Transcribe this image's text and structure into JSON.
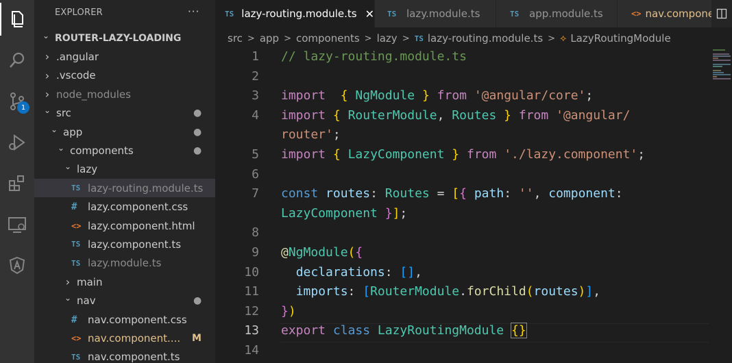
{
  "explorer": {
    "title": "EXPLORER",
    "more_icon": "ellipsis-icon",
    "tree": [
      {
        "label": "ROUTER-LAZY-LOADING",
        "type": "root-folder",
        "expanded": true,
        "depth": 0
      },
      {
        "label": ".angular",
        "type": "folder",
        "expanded": false,
        "depth": 1
      },
      {
        "label": ".vscode",
        "type": "folder",
        "expanded": false,
        "depth": 1
      },
      {
        "label": "node_modules",
        "type": "folder",
        "expanded": false,
        "depth": 1,
        "dimmed": true
      },
      {
        "label": "src",
        "type": "folder",
        "expanded": true,
        "depth": 1,
        "decoration": "●"
      },
      {
        "label": "app",
        "type": "folder",
        "expanded": true,
        "depth": 2,
        "decoration": "●"
      },
      {
        "label": "components",
        "type": "folder",
        "expanded": true,
        "depth": 3,
        "decoration": "●"
      },
      {
        "label": "lazy",
        "type": "folder",
        "expanded": true,
        "depth": 4
      },
      {
        "label": "lazy-routing.module.ts",
        "type": "ts",
        "icon": "TS",
        "depth": 5,
        "selected": true,
        "dimmed": true
      },
      {
        "label": "lazy.component.css",
        "type": "css",
        "icon": "#",
        "depth": 5
      },
      {
        "label": "lazy.component.html",
        "type": "html",
        "icon": "<>",
        "depth": 5
      },
      {
        "label": "lazy.component.ts",
        "type": "ts",
        "icon": "TS",
        "depth": 5
      },
      {
        "label": "lazy.module.ts",
        "type": "ts",
        "icon": "TS",
        "depth": 5,
        "dimmed": true
      },
      {
        "label": "main",
        "type": "folder",
        "expanded": false,
        "depth": 4
      },
      {
        "label": "nav",
        "type": "folder",
        "expanded": true,
        "depth": 4,
        "decoration": "●"
      },
      {
        "label": "nav.component.css",
        "type": "css",
        "icon": "#",
        "depth": 5
      },
      {
        "label": "nav.component....",
        "type": "html",
        "icon": "<>",
        "depth": 5,
        "modified": true,
        "decoration": "M"
      },
      {
        "label": "nav.component.ts",
        "type": "ts",
        "icon": "TS",
        "depth": 5
      }
    ]
  },
  "activity_bar": {
    "items": [
      {
        "name": "explorer-icon",
        "active": true
      },
      {
        "name": "search-icon"
      },
      {
        "name": "source-control-icon",
        "badge": "1"
      },
      {
        "name": "run-debug-icon"
      },
      {
        "name": "extensions-icon"
      },
      {
        "name": "remote-explorer-icon"
      },
      {
        "name": "angular-icon"
      }
    ]
  },
  "tabs": [
    {
      "label": "lazy-routing.module.ts",
      "icon": "TS",
      "active": true,
      "close": "✕"
    },
    {
      "label": "lazy.module.ts",
      "icon": "TS"
    },
    {
      "label": "app.module.ts",
      "icon": "TS"
    },
    {
      "label": "nav.component.html",
      "icon": "<>"
    }
  ],
  "breadcrumb": {
    "parts": [
      "src",
      "app",
      "components",
      "lazy"
    ],
    "file": "lazy-routing.module.ts",
    "file_icon": "TS",
    "symbol": "LazyRoutingModule",
    "separator": ">"
  },
  "editor": {
    "current_line": 13,
    "lines": [
      {
        "num": "1",
        "tokens": [
          [
            "c-com",
            "// lazy-routing.module.ts"
          ]
        ]
      },
      {
        "num": "2",
        "tokens": []
      },
      {
        "num": "3",
        "tokens": [
          [
            "c-kw",
            "import"
          ],
          [
            "",
            "  "
          ],
          [
            "c-br1",
            "{"
          ],
          [
            "",
            " "
          ],
          [
            "c-cls",
            "NgModule"
          ],
          [
            "",
            " "
          ],
          [
            "c-br1",
            "}"
          ],
          [
            "",
            " "
          ],
          [
            "c-kw",
            "from"
          ],
          [
            "",
            " "
          ],
          [
            "c-str",
            "'@angular/core'"
          ],
          [
            "",
            ";"
          ]
        ]
      },
      {
        "num": "4",
        "tokens": [
          [
            "c-kw",
            "import"
          ],
          [
            "",
            " "
          ],
          [
            "c-br1",
            "{"
          ],
          [
            "",
            " "
          ],
          [
            "c-cls",
            "RouterModule"
          ],
          [
            "",
            ", "
          ],
          [
            "c-cls",
            "Routes"
          ],
          [
            "",
            " "
          ],
          [
            "c-br1",
            "}"
          ],
          [
            "",
            " "
          ],
          [
            "c-kw",
            "from"
          ],
          [
            "",
            " "
          ],
          [
            "c-str",
            "'@angular/"
          ]
        ]
      },
      {
        "num": "",
        "tokens": [
          [
            "c-str",
            "router'"
          ],
          [
            "",
            ";"
          ]
        ]
      },
      {
        "num": "5",
        "tokens": [
          [
            "c-kw",
            "import"
          ],
          [
            "",
            " "
          ],
          [
            "c-br1",
            "{"
          ],
          [
            "",
            " "
          ],
          [
            "c-cls",
            "LazyComponent"
          ],
          [
            "",
            " "
          ],
          [
            "c-br1",
            "}"
          ],
          [
            "",
            " "
          ],
          [
            "c-kw",
            "from"
          ],
          [
            "",
            " "
          ],
          [
            "c-str",
            "'./lazy.component'"
          ],
          [
            "",
            ";"
          ]
        ]
      },
      {
        "num": "6",
        "tokens": []
      },
      {
        "num": "7",
        "tokens": [
          [
            "c-kw2",
            "const"
          ],
          [
            "",
            " "
          ],
          [
            "c-var",
            "routes"
          ],
          [
            "",
            ": "
          ],
          [
            "c-cls",
            "Routes"
          ],
          [
            "",
            " = "
          ],
          [
            "c-br1",
            "["
          ],
          [
            "c-br2",
            "{"
          ],
          [
            "",
            " "
          ],
          [
            "c-var",
            "path"
          ],
          [
            "",
            ": "
          ],
          [
            "c-str",
            "''"
          ],
          [
            "",
            ", "
          ],
          [
            "c-var",
            "component"
          ],
          [
            "",
            ":"
          ]
        ]
      },
      {
        "num": "",
        "tokens": [
          [
            "c-cls",
            "LazyComponent"
          ],
          [
            "",
            " "
          ],
          [
            "c-br2",
            "}"
          ],
          [
            "c-br1",
            "]"
          ],
          [
            "",
            ";"
          ]
        ]
      },
      {
        "num": "8",
        "tokens": []
      },
      {
        "num": "9",
        "tokens": [
          [
            "c-fn",
            "@"
          ],
          [
            "c-cls",
            "NgModule"
          ],
          [
            "c-br1",
            "("
          ],
          [
            "c-br2",
            "{"
          ]
        ]
      },
      {
        "num": "10",
        "tokens": [
          [
            "",
            "  "
          ],
          [
            "c-var",
            "declarations"
          ],
          [
            "",
            ": "
          ],
          [
            "c-br3",
            "[]"
          ],
          [
            "",
            ","
          ]
        ]
      },
      {
        "num": "11",
        "tokens": [
          [
            "",
            "  "
          ],
          [
            "c-var",
            "imports"
          ],
          [
            "",
            ": "
          ],
          [
            "c-br3",
            "["
          ],
          [
            "c-cls",
            "RouterModule"
          ],
          [
            "",
            "."
          ],
          [
            "c-fn",
            "forChild"
          ],
          [
            "c-br1",
            "("
          ],
          [
            "c-var",
            "routes"
          ],
          [
            "c-br1",
            ")"
          ],
          [
            "c-br3",
            "]"
          ],
          [
            "",
            ","
          ]
        ]
      },
      {
        "num": "12",
        "tokens": [
          [
            "c-br2",
            "}"
          ],
          [
            "c-br1",
            ")"
          ]
        ]
      },
      {
        "num": "13",
        "tokens": [
          [
            "c-kw",
            "export"
          ],
          [
            "",
            " "
          ],
          [
            "c-kw2",
            "class"
          ],
          [
            "",
            " "
          ],
          [
            "c-cls",
            "LazyRoutingModule"
          ],
          [
            "",
            " "
          ],
          [
            "c-br1 bracket-match",
            "{}"
          ]
        ]
      },
      {
        "num": "14",
        "tokens": []
      }
    ]
  },
  "colors": {
    "activity_bg": "#333333",
    "sidebar_bg": "#252526",
    "editor_bg": "#1e1e1e",
    "ts_icon": "#519aba",
    "html_icon": "#e37933",
    "modified": "#e2c08d",
    "badge": "#0e70c0"
  }
}
